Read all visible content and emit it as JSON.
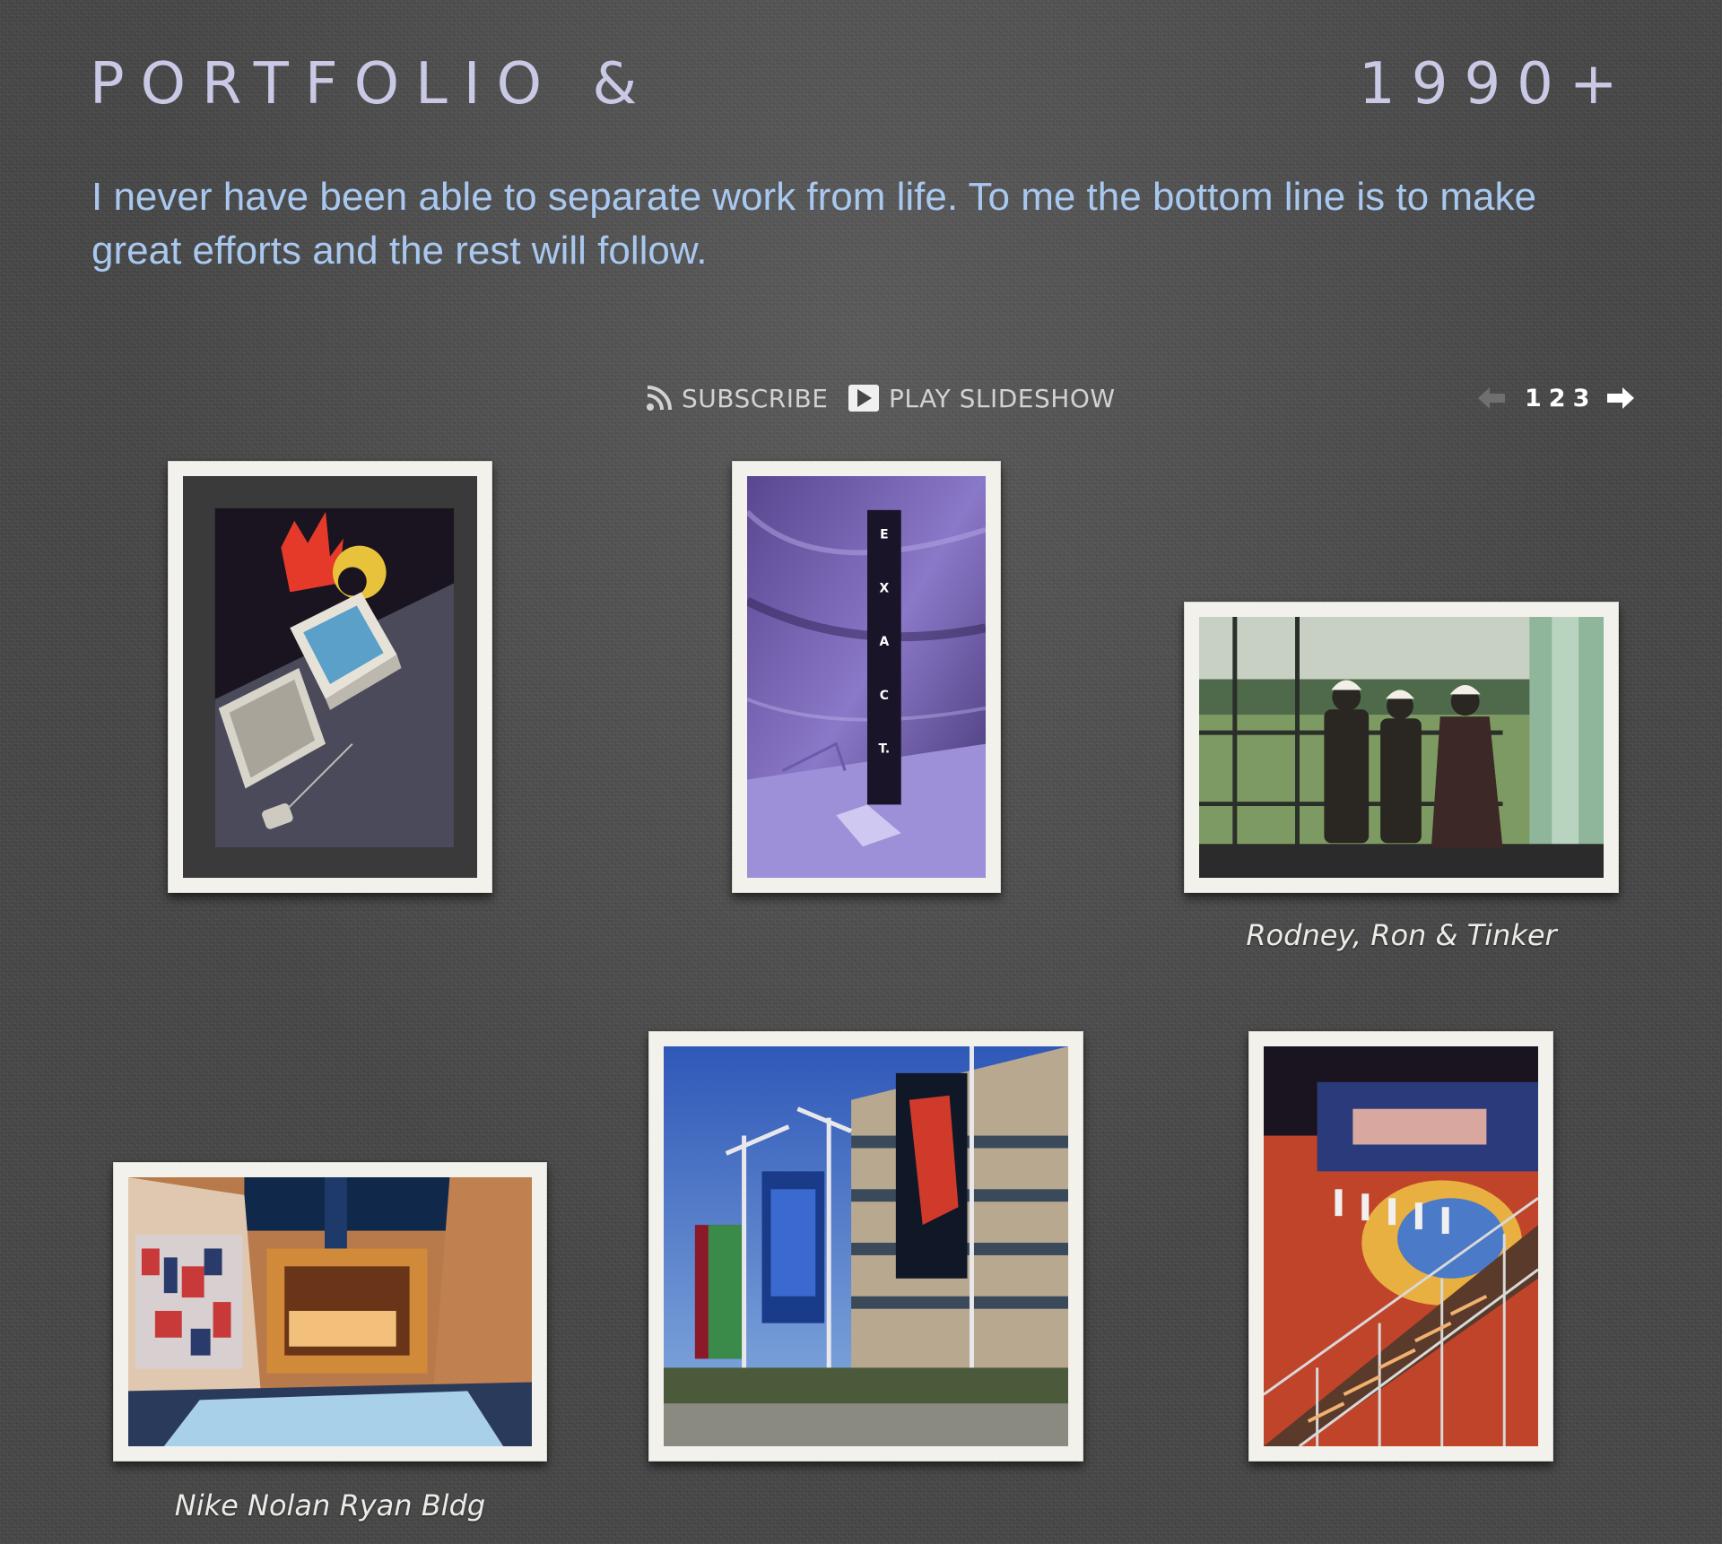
{
  "header": {
    "title_left": "PORTFOLIO &",
    "title_right": "1990+"
  },
  "intro": {
    "text": "I never have been able to separate work from life. To me the bottom line is to make great efforts and the rest will follow."
  },
  "toolbar": {
    "subscribe_label": "SUBSCRIBE",
    "subscribe_icon": "rss-icon",
    "slideshow_label": "PLAY SLIDESHOW",
    "slideshow_icon": "play-icon"
  },
  "pager": {
    "pages": [
      "1",
      "2",
      "3"
    ],
    "prev_icon": "arrow-left-icon",
    "next_icon": "arrow-right-icon"
  },
  "gallery": {
    "photos": [
      {
        "caption": ""
      },
      {
        "caption": ""
      },
      {
        "caption": "Rodney, Ron & Tinker"
      },
      {
        "caption": "Nike Nolan Ryan Bldg"
      },
      {
        "caption": ""
      },
      {
        "caption": ""
      }
    ],
    "exact_letters": [
      "E",
      "X",
      "A",
      "C",
      "T."
    ]
  },
  "colors": {
    "background": "#474747",
    "title": "#c9c9e6",
    "intro_text": "#a9c8ef",
    "frame": "#f3f1ec",
    "toolbar_text": "#d2d2d2"
  }
}
